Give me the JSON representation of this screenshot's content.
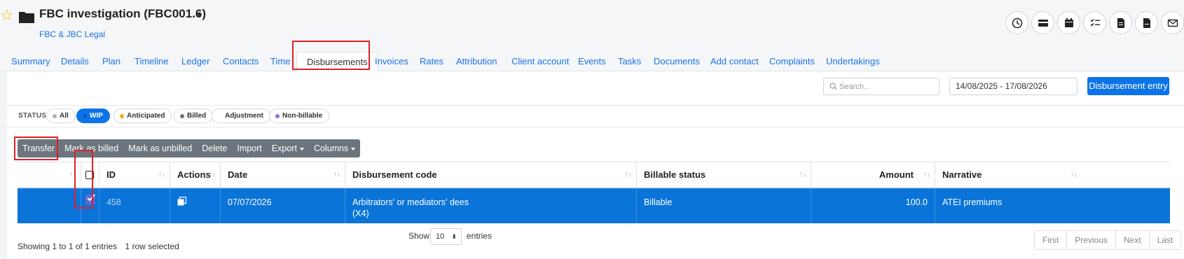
{
  "header": {
    "title": "FBC investigation (FBC001.6)",
    "client": "FBC & JBC Legal",
    "icons": [
      "clock-icon",
      "card-icon",
      "calendar-icon",
      "checklist-icon",
      "document-icon",
      "file-icon",
      "mail-icon"
    ]
  },
  "tabs": [
    "Summary",
    "Details",
    "Plan",
    "Timeline",
    "Ledger",
    "Contacts",
    "Time",
    "Disbursements",
    "Invoices",
    "Rates",
    "Attribution",
    "Client account",
    "Events",
    "Tasks",
    "Documents",
    "Add contact",
    "Complaints",
    "Undertakings"
  ],
  "active_tab": "Disbursements",
  "search": {
    "placeholder": "Search..."
  },
  "date_range": "14/08/2025 - 17/08/2026",
  "entry_button": "Disbursement entry",
  "status": {
    "label": "STATUS",
    "filters": [
      {
        "label": "All",
        "dot": "#b0b4ba"
      },
      {
        "label": "WIP",
        "dot": "#0a5cc4",
        "active": true
      },
      {
        "label": "Anticipated",
        "dot": "#f5a623"
      },
      {
        "label": "Billed",
        "dot": "#6c757d"
      },
      {
        "label": "Adjustment",
        "dot": ""
      },
      {
        "label": "Non-billable",
        "dot": "#9b6dde"
      }
    ]
  },
  "toolbar": {
    "transfer": "Transfer",
    "mark_billed": "Mark as billed",
    "mark_unbilled": "Mark as unbilled",
    "delete": "Delete",
    "import": "Import",
    "export": "Export",
    "columns": "Columns"
  },
  "table": {
    "headers": {
      "id": "ID",
      "actions": "Actions",
      "date": "Date",
      "code": "Disbursement code",
      "billable": "Billable status",
      "amount": "Amount",
      "narrative": "Narrative"
    },
    "rows": [
      {
        "id": "458",
        "date": "07/07/2026",
        "code": "Arbitrators' or mediators' dees",
        "code_sub": "(X4)",
        "billable": "Billable",
        "amount": "100.0",
        "narrative": "ATEI premiums"
      }
    ]
  },
  "footer": {
    "info": "Showing 1 to 1 of 1 entries",
    "selected": "1 row selected",
    "show": "Show",
    "page_size": "10",
    "entries": "entries",
    "pager": [
      "First",
      "Previous",
      "Next",
      "Last"
    ]
  },
  "colors": {
    "accent": "#0d74e8",
    "highlight": "#e0202a",
    "selected_row": "#0a74d8"
  }
}
